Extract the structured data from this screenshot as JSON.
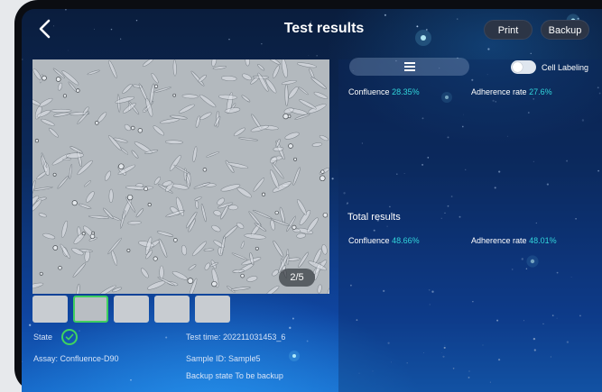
{
  "header": {
    "title": "Test results",
    "print_label": "Print",
    "backup_label": "Backup"
  },
  "viewer": {
    "page_indicator": "2/5",
    "thumbnail_count": 5,
    "active_thumbnail": 2
  },
  "sample_info": {
    "state_label": "State",
    "assay": "Assay: Confluence-D90",
    "test_time": "Test time: 202211031453_6",
    "sample_id": "Sample ID: Sample5",
    "backup_state": "Backup state To be backup"
  },
  "current_results": {
    "cell_labeling_label": "Cell Labeling",
    "cell_labeling_on": true,
    "confluence_label": "Confluence",
    "confluence_value": "28.35%",
    "adherence_label": "Adherence rate",
    "adherence_value": "27.6%"
  },
  "total_results": {
    "title": "Total results",
    "confluence_label": "Confluence",
    "confluence_value": "48.66%",
    "adherence_label": "Adherence rate",
    "adherence_value": "48.01%"
  },
  "colors": {
    "accent_value": "#31d6dc",
    "success": "#3fd45e",
    "background_top": "#0a1d3d",
    "background_bottom": "#1669c9"
  },
  "icons": {
    "back": "chevron-left-icon",
    "view_toggle": "list-icon",
    "state": "check-circle-icon"
  }
}
